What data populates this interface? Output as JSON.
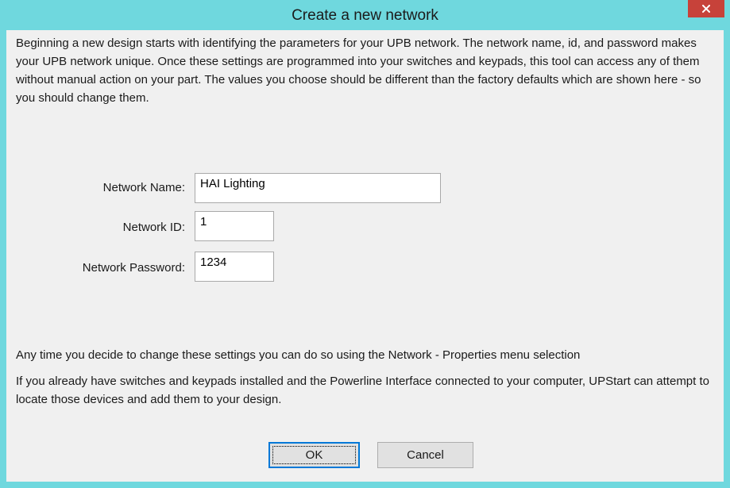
{
  "window": {
    "title": "Create a new network",
    "close_icon": "close-icon"
  },
  "intro": {
    "text": "Beginning a new design starts with identifying the parameters for your UPB network.  The network name, id, and password makes your UPB network unique.  Once these settings are programmed into your switches and keypads, this tool can access any of them without manual action on your part.  The values you choose should be different than the factory defaults which are shown here - so you should change them."
  },
  "form": {
    "network_name_label": "Network Name:",
    "network_name_value": "HAI Lighting",
    "network_id_label": "Network ID:",
    "network_id_value": "1",
    "network_password_label": "Network Password:",
    "network_password_value": "1234"
  },
  "notes": {
    "change_settings": "Any time you decide to change these settings you can do so using the Network - Properties menu selection",
    "locate_devices": "If you already have switches and keypads installed and the Powerline Interface connected to your computer, UPStart can attempt to locate those devices and add them to your design."
  },
  "buttons": {
    "ok_label": "OK",
    "cancel_label": "Cancel"
  },
  "colors": {
    "titlebar": "#6fd8de",
    "close_button": "#c7423a",
    "client_background": "#f0f0f0",
    "default_button_border": "#0078d7"
  }
}
